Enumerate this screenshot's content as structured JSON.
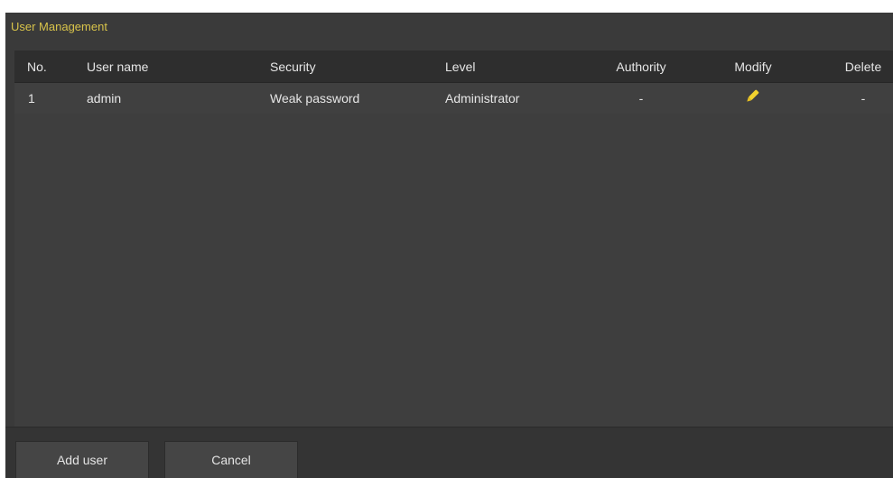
{
  "panel": {
    "title": "User Management"
  },
  "table": {
    "headers": {
      "no": "No.",
      "user_name": "User name",
      "security": "Security",
      "level": "Level",
      "authority": "Authority",
      "modify": "Modify",
      "delete": "Delete"
    },
    "rows": [
      {
        "no": "1",
        "user_name": "admin",
        "security": "Weak password",
        "level": "Administrator",
        "authority": "-",
        "modify_icon": "pencil-icon",
        "delete": "-"
      }
    ]
  },
  "buttons": {
    "add_user": "Add user",
    "cancel": "Cancel"
  },
  "colors": {
    "accent": "#d8c34a",
    "panel_bg": "#3a3a3a",
    "header_bg": "#2e2e2e",
    "pencil": "#f2d22e",
    "text": "#e6e6e6"
  }
}
